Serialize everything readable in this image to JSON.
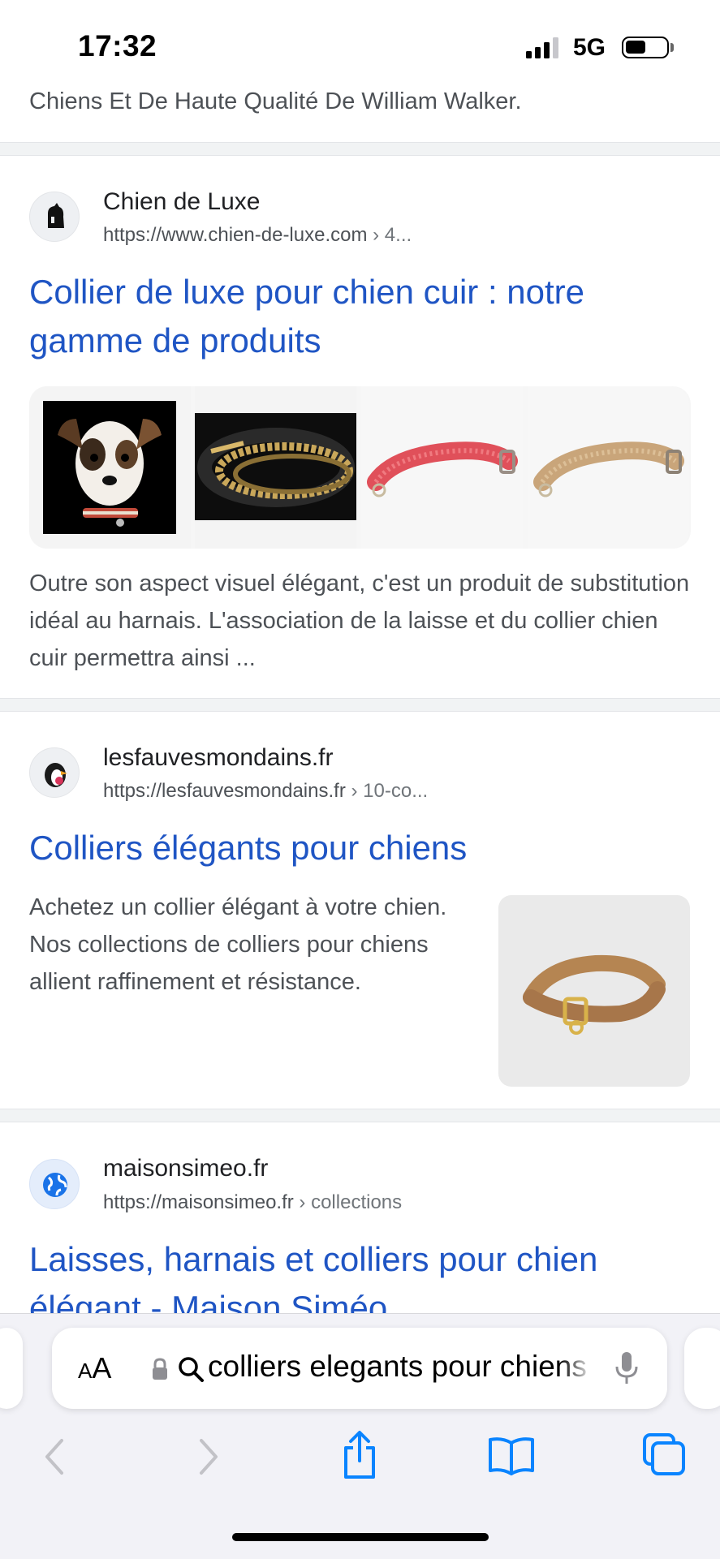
{
  "status_bar": {
    "time": "17:32",
    "network": "5G"
  },
  "top_snippet": "Chiens Et De Haute Qualité De William Walker.",
  "results": [
    {
      "site_name": "Chien de Luxe",
      "url": "https://www.chien-de-luxe.com",
      "url_crumb": " › 4...",
      "title": "Collier de luxe pour chien cuir : notre gamme de produits",
      "description": "Outre son aspect visuel élégant, c'est un produit de substitution idéal au harnais. L'association de la laisse et du collier chien cuir permettra ainsi ..."
    },
    {
      "site_name": "lesfauvesmondains.fr",
      "url": "https://lesfauvesmondains.fr",
      "url_crumb": " › 10-co...",
      "title": "Colliers élégants pour chiens",
      "description": "Achetez un collier élégant à votre chien. Nos collections de colliers pour chiens allient raffinement et résistance."
    },
    {
      "site_name": "maisonsimeo.fr",
      "url": "https://maisonsimeo.fr",
      "url_crumb": " › collections",
      "title": "Laisses, harnais et colliers pour chien élégant - Maison Siméo"
    }
  ],
  "browser": {
    "text_size_label_small": "A",
    "text_size_label_large": "A",
    "address_value": "colliers elegants pour chiens"
  },
  "colors": {
    "link": "#1f55c4",
    "chrome_bg": "#f2f2f7",
    "ios_blue": "#0a84ff"
  },
  "icons": [
    "signal-icon",
    "battery-icon",
    "lock-icon",
    "search-icon",
    "microphone-icon",
    "back-icon",
    "forward-icon",
    "share-icon",
    "bookmarks-icon",
    "tabs-icon",
    "globe-icon"
  ]
}
